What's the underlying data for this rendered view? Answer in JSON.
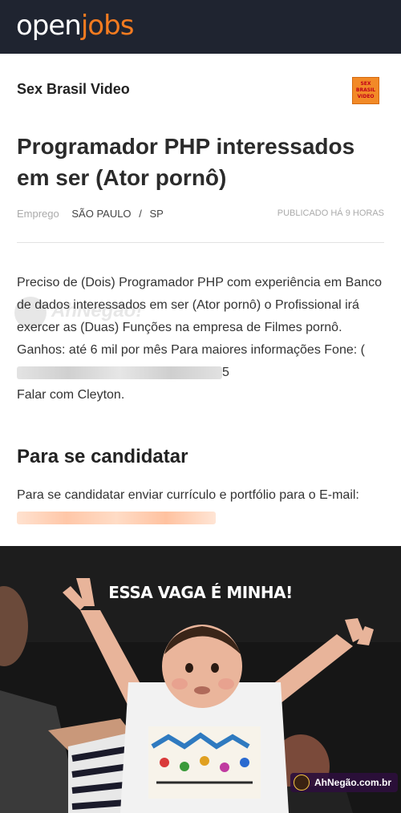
{
  "header": {
    "logo_open": "open",
    "logo_jobs": "jobs"
  },
  "job": {
    "company": "Sex Brasil Video",
    "company_logo_lines": [
      "SEX",
      "BRASIL",
      "VIDEO"
    ],
    "title": "Programador PHP interessados em ser (Ator pornô)",
    "type": "Emprego",
    "city": "SÃO PAULO",
    "separator": "/",
    "state": "SP",
    "published": "PUBLICADO HÁ 9 HORAS",
    "description_main": "Preciso de (Dois) Programador PHP com experiência em Banco de dados interessados em ser (Ator pornô) o Profissional irá exercer as (Duas) Funções na empresa de Filmes pornô. Ganhos: até 6 mil por mês Para maiores informações Fone: (",
    "description_phone_end": "5",
    "description_end": "Falar com Cleyton."
  },
  "apply": {
    "heading": "Para se candidatar",
    "text": "Para se candidatar enviar currículo e portfólio para o E-mail:"
  },
  "watermark": {
    "text": "AhNegão!"
  },
  "meme": {
    "caption": "ESSA VAGA É MINHA!",
    "badge": "AhNegão.com.br"
  },
  "colors": {
    "topbar": "#1f2430",
    "brand_orange": "#f47b20"
  }
}
